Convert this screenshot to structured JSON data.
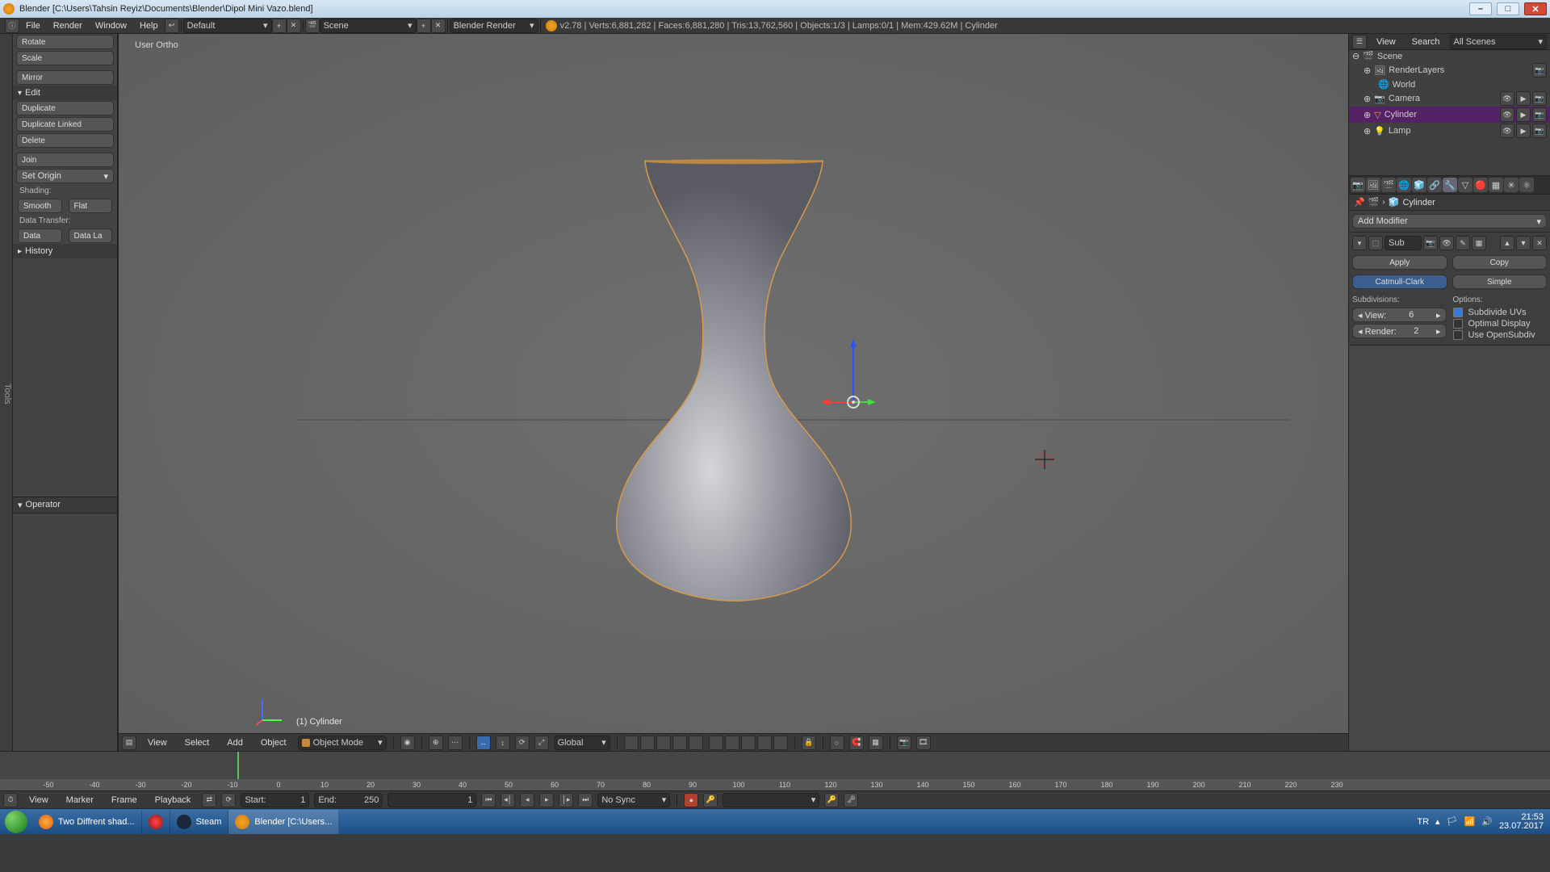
{
  "win_title": "Blender [C:\\Users\\Tahsin Reyiz\\Documents\\Blender\\Dipol Mini Vazo.blend]",
  "menus": {
    "file": "File",
    "render": "Render",
    "window": "Window",
    "help": "Help"
  },
  "layout_name": "Default",
  "scene_name": "Scene",
  "engine": "Blender Render",
  "stats": "v2.78 | Verts:6,881,282 | Faces:6,881,280 | Tris:13,762,560 | Objects:1/3 | Lamps:0/1 | Mem:429.62M | Cylinder",
  "tools": {
    "rotate": "Rotate",
    "scale": "Scale",
    "mirror": "Mirror",
    "edit_header": "Edit",
    "duplicate": "Duplicate",
    "dup_linked": "Duplicate Linked",
    "delete": "Delete",
    "join": "Join",
    "set_origin": "Set Origin",
    "shading_label": "Shading:",
    "smooth": "Smooth",
    "flat": "Flat",
    "data_transfer_label": "Data Transfer:",
    "data": "Data",
    "data_la": "Data La",
    "history": "History"
  },
  "operator": "Operator",
  "vp": {
    "overlay": "User Ortho",
    "obj_label": "(1) Cylinder"
  },
  "header3d": {
    "view": "View",
    "select": "Select",
    "add": "Add",
    "object": "Object",
    "mode": "Object Mode",
    "orientation": "Global"
  },
  "outliner": {
    "view": "View",
    "search": "Search",
    "filter": "All Scenes",
    "scene": "Scene",
    "renderlayers": "RenderLayers",
    "world": "World",
    "camera": "Camera",
    "cylinder": "Cylinder",
    "lamp": "Lamp"
  },
  "props": {
    "obj": "Cylinder",
    "add_mod": "Add Modifier",
    "mod_name": "Sub",
    "apply": "Apply",
    "copy": "Copy",
    "catmull": "Catmull-Clark",
    "simple": "Simple",
    "subdiv_label": "Subdivisions:",
    "options_label": "Options:",
    "view_label": "View:",
    "view_val": "6",
    "render_label": "Render:",
    "render_val": "2",
    "subdiv_uv": "Subdivide UVs",
    "opt_disp": "Optimal Display",
    "opensub": "Use OpenSubdiv"
  },
  "timeline": {
    "view": "View",
    "marker": "Marker",
    "frame": "Frame",
    "playback": "Playback",
    "start_label": "Start:",
    "start_val": "1",
    "end_label": "End:",
    "end_val": "250",
    "cur_val": "1",
    "sync": "No Sync",
    "ticks": [
      "-50",
      "-40",
      "-30",
      "-20",
      "-10",
      "0",
      "10",
      "20",
      "30",
      "40",
      "50",
      "60",
      "70",
      "80",
      "90",
      "100",
      "110",
      "120",
      "130",
      "140",
      "150",
      "160",
      "170",
      "180",
      "190",
      "200",
      "210",
      "220",
      "230"
    ]
  },
  "taskbar": {
    "firefox": "Two Diffrent shad...",
    "steam": "Steam",
    "blender": "Blender [C:\\Users...",
    "lang": "TR",
    "time": "21:53",
    "date": "23.07.2017"
  }
}
